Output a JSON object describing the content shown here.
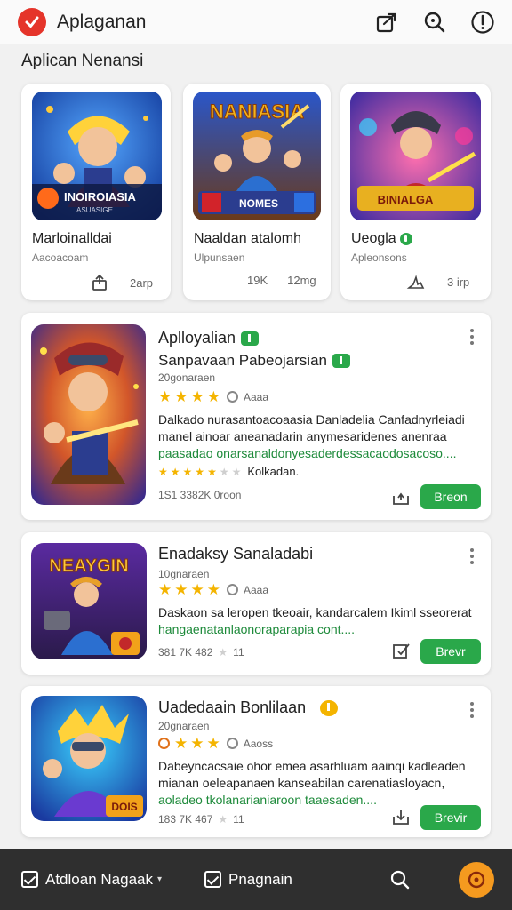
{
  "header": {
    "title": "Aplaganan",
    "icons": [
      "external-share-icon",
      "search-icon",
      "info-icon"
    ]
  },
  "section": {
    "title": "Aplican Nenansi"
  },
  "featured": [
    {
      "title": "Marloinalldai",
      "subtitle": "Aacoacoam",
      "meta_right": "2arp",
      "image_text": "INOIROIASIA",
      "image_subtext": "ASUASIGE",
      "colors": [
        "#1e6bd6",
        "#ff7a1a"
      ]
    },
    {
      "title": "Naaldan atalomh",
      "subtitle": "Ulpunsaen",
      "meta_left": "19K",
      "meta_right": "12mg",
      "image_text": "NANIASIA",
      "image_subtext": "NOMES",
      "colors": [
        "#2a56c9",
        "#f2b31b"
      ]
    },
    {
      "title": "Ueogla",
      "subtitle": "Apleonsons",
      "meta_right": "3 irp",
      "image_text": "BINIALGA",
      "colors": [
        "#6a3ad0",
        "#e24ca0"
      ]
    }
  ],
  "apps": [
    {
      "title": "Aplloyalian",
      "subtitle": "Sanpavaan Pabeojarsian",
      "developer": "20gonaraen",
      "rating_text": "Aaaa",
      "description_line1": "Dalkado nurasantoacoaasia Danladelia Canfadnyrleiadi",
      "description_line2": "manel ainoar aneanadarin anymesaridenes anenraa",
      "description_green": "paasadao onarsanaldonyesaderdessacaodosacoso....",
      "mini_rating_label": "Kolkadan.",
      "stats": "1S1 3382K 0roon",
      "get_label": "Breon"
    },
    {
      "title": "Enadaksy Sanaladabi",
      "developer": "10gnaraen",
      "rating_text": "Aaaa",
      "description_line1": "Daskaon sa leropen tkeoair, kandarcalem Ikiml sseorerat",
      "description_green": "hangaenatanlaonoraparapia cont....",
      "stats": "381 7K 482",
      "stats_extra": "11",
      "get_label": "Brevr",
      "image_text": "NEAYGIN"
    },
    {
      "title": "Uadedaain Bonlilaan",
      "developer": "20gnaraen",
      "rating_text": "Aaoss",
      "description_line1": "Dabeyncacsaie ohor emea asarhluam aainqi kadleaden",
      "description_line2": "mianan oeleapanaen kanseabilan carenatiasloyacn,",
      "description_green": "aoladeo tkolanarianiaroon taaesaden....",
      "stats": "183 7K 467",
      "stats_extra": "11",
      "get_label": "Brevir",
      "image_text": "DOIS"
    }
  ],
  "bottom_bar": {
    "item1": "Atdloan Nagaak",
    "item2": "Pnagnain"
  },
  "colors": {
    "accent_green": "#2aa84a",
    "logo_red": "#e5342a",
    "fab_orange": "#f59a1f",
    "star_yellow": "#f4b400"
  }
}
